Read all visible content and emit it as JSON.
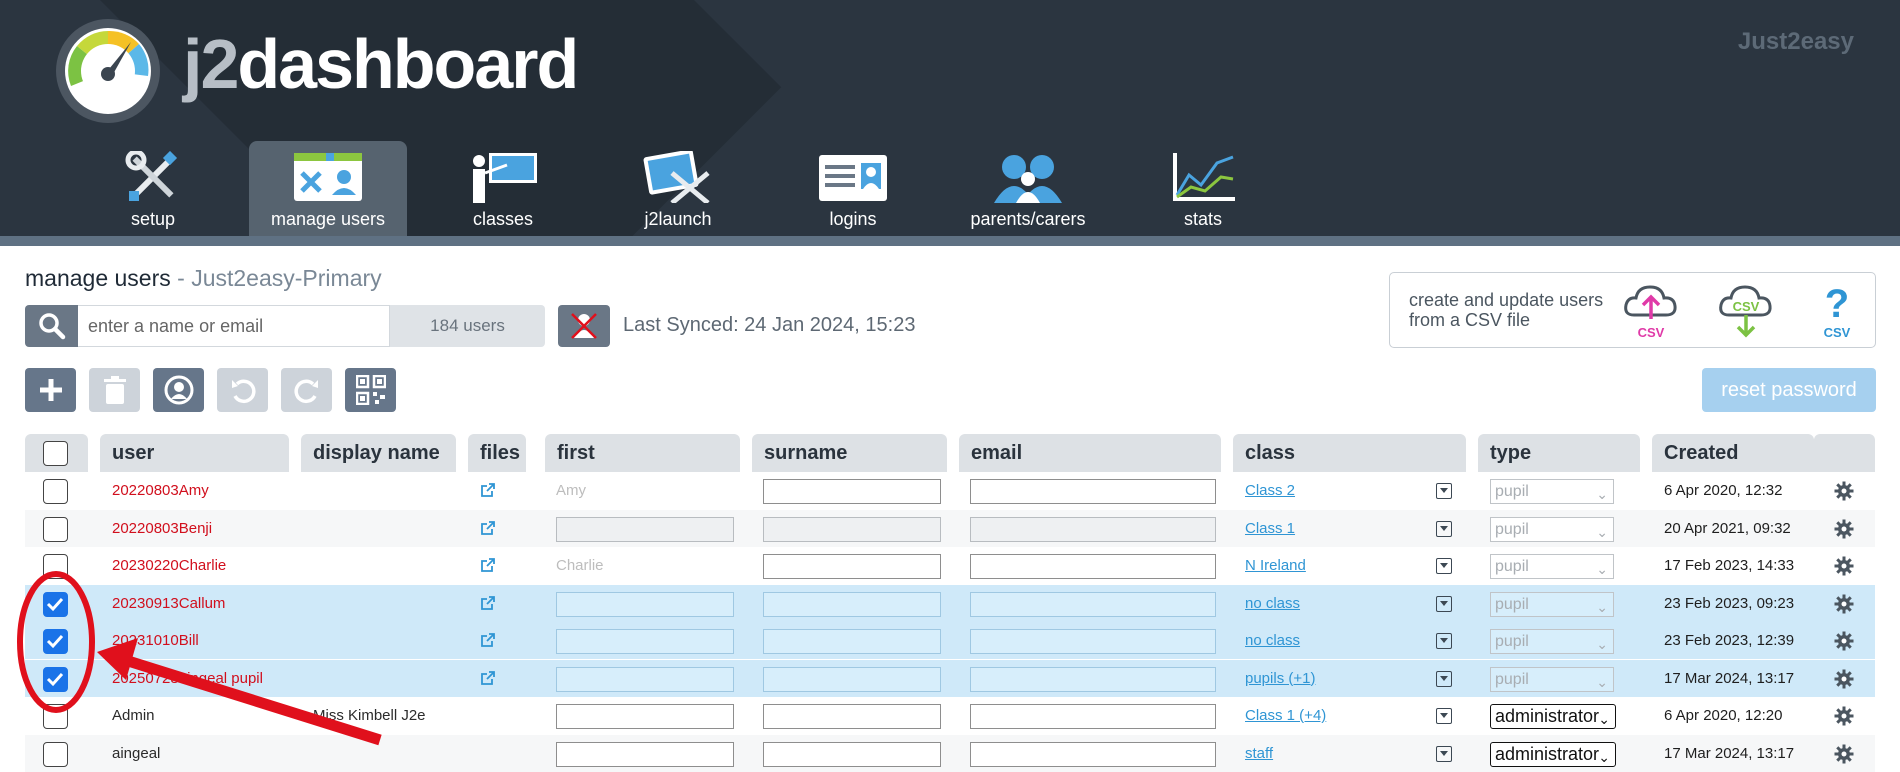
{
  "header": {
    "logo_prefix": "j2",
    "logo_main": "dashboard",
    "brand": "Just2easy"
  },
  "nav": [
    {
      "label": "setup",
      "icon": "tools-icon",
      "active": false
    },
    {
      "label": "manage users",
      "icon": "manage-users-icon",
      "active": true
    },
    {
      "label": "classes",
      "icon": "classroom-icon",
      "active": false
    },
    {
      "label": "j2launch",
      "icon": "launch-icon",
      "active": false
    },
    {
      "label": "logins",
      "icon": "id-card-icon",
      "active": false
    },
    {
      "label": "parents/carers",
      "icon": "people-icon",
      "active": false
    },
    {
      "label": "stats",
      "icon": "chart-icon",
      "active": false
    }
  ],
  "page": {
    "title": "manage users",
    "separator": " - ",
    "school": "Just2easy-Primary"
  },
  "search": {
    "placeholder": "enter a name or email",
    "count": "184 users"
  },
  "sync": {
    "text": "Last Synced: 24 Jan 2024, 15:23"
  },
  "csv": {
    "text": "create and update users from a CSV file",
    "upload_label": "CSV",
    "download_label": "CSV",
    "help_label": "CSV"
  },
  "toolbar": {
    "reset_password": "reset password"
  },
  "table": {
    "headers": {
      "user": "user",
      "display": "display name",
      "files": "files",
      "first": "first",
      "surname": "surname",
      "email": "email",
      "class": "class",
      "type": "type",
      "created": "Created"
    },
    "rows": [
      {
        "user": "20220803Amy",
        "display": "",
        "first": "Amy",
        "class": "Class 2",
        "type": "pupil",
        "created": "6 Apr 2020, 12:32"
      },
      {
        "user": "20220803Benji",
        "display": "",
        "first": "",
        "class": "Class 1",
        "type": "pupil",
        "created": "20 Apr 2021, 09:32"
      },
      {
        "user": "20230220Charlie",
        "display": "",
        "first": "Charlie",
        "class": "N Ireland",
        "type": "pupil",
        "created": "17 Feb 2023, 14:33"
      },
      {
        "user": "20230913Callum",
        "display": "",
        "first": "",
        "class": "no class",
        "type": "pupil",
        "created": "23 Feb 2023, 09:23"
      },
      {
        "user": "20231010Bill",
        "display": "",
        "first": "",
        "class": "no class",
        "type": "pupil",
        "created": "23 Feb 2023, 12:39"
      },
      {
        "user": "20250728aingeal pupil",
        "display": "",
        "first": "",
        "class": "pupils (+1)",
        "type": "pupil",
        "created": "17 Mar 2024, 13:17"
      },
      {
        "user": "Admin",
        "display": "Miss Kimbell J2e",
        "first": "",
        "class": "Class 1 (+4)",
        "type": "administrator",
        "created": "6 Apr 2020, 12:20"
      },
      {
        "user": "aingeal",
        "display": "",
        "first": "",
        "class": "staff",
        "type": "administrator",
        "created": "17 Mar 2024, 13:17"
      }
    ]
  },
  "colors": {
    "header_bg": "#2b3540",
    "selected_row": "#cfe9f9",
    "username_red": "#d10f1d",
    "link_blue": "#2f95d4",
    "annotation_red": "#e0101c"
  }
}
